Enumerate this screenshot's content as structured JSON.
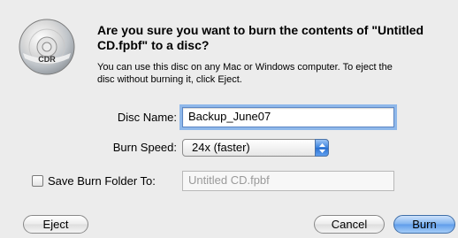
{
  "dialog": {
    "title": "Are you sure you want to burn the contents of \"Untitled CD.fpbf\" to a disc?",
    "message": "You can use this disc on any Mac or Windows computer. To eject the\ndisc without burning it, click Eject.",
    "icon": {
      "name": "cd-recordable-icon",
      "label": "CDR"
    }
  },
  "form": {
    "disc_name_label": "Disc Name:",
    "disc_name_value": "Backup_June07",
    "burn_speed_label": "Burn Speed:",
    "burn_speed_value": "24x (faster)",
    "save_folder_label": "Save Burn Folder To:",
    "save_folder_checked": false,
    "save_folder_value": "Untitled CD.fpbf"
  },
  "buttons": {
    "eject": "Eject",
    "cancel": "Cancel",
    "burn": "Burn"
  },
  "colors": {
    "background": "#ececec",
    "default_button": "#5e9cea",
    "focus_ring": "#8fb8ea"
  }
}
